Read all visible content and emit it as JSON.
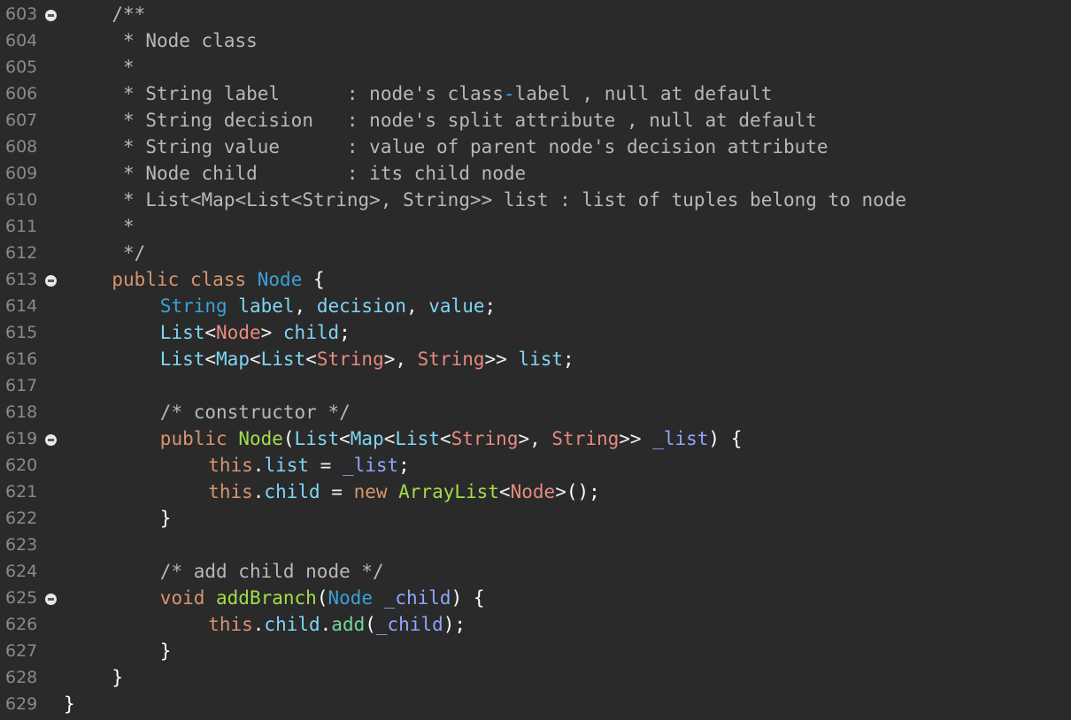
{
  "editor": {
    "indent_unit": 4,
    "lines": [
      {
        "num": "603",
        "fold": true,
        "indent": 1,
        "tokens": [
          {
            "t": "/**",
            "c": "cm"
          }
        ]
      },
      {
        "num": "604",
        "fold": false,
        "indent": 1,
        "tokens": [
          {
            "t": " * Node class",
            "c": "cm"
          }
        ]
      },
      {
        "num": "605",
        "fold": false,
        "indent": 1,
        "tokens": [
          {
            "t": " *",
            "c": "cm"
          }
        ]
      },
      {
        "num": "606",
        "fold": false,
        "indent": 1,
        "tokens": [
          {
            "t": " * String label      : node's class",
            "c": "cm"
          },
          {
            "t": "-",
            "c": "ty"
          },
          {
            "t": "label , null at default",
            "c": "cm"
          }
        ]
      },
      {
        "num": "607",
        "fold": false,
        "indent": 1,
        "tokens": [
          {
            "t": " * String decision   : node's split attribute , null at default",
            "c": "cm"
          }
        ]
      },
      {
        "num": "608",
        "fold": false,
        "indent": 1,
        "tokens": [
          {
            "t": " * String value      : value of parent node's decision attribute",
            "c": "cm"
          }
        ]
      },
      {
        "num": "609",
        "fold": false,
        "indent": 1,
        "tokens": [
          {
            "t": " * Node child        : its child node",
            "c": "cm"
          }
        ]
      },
      {
        "num": "610",
        "fold": false,
        "indent": 1,
        "tokens": [
          {
            "t": " * List<Map<List<String>, String>> list : list of tuples belong to node",
            "c": "cm"
          }
        ]
      },
      {
        "num": "611",
        "fold": false,
        "indent": 1,
        "tokens": [
          {
            "t": " *",
            "c": "cm"
          }
        ]
      },
      {
        "num": "612",
        "fold": false,
        "indent": 1,
        "tokens": [
          {
            "t": " */",
            "c": "cm"
          }
        ]
      },
      {
        "num": "613",
        "fold": true,
        "indent": 1,
        "tokens": [
          {
            "t": "public class ",
            "c": "kw"
          },
          {
            "t": "Node",
            "c": "ty"
          },
          {
            "t": " {",
            "c": "pu"
          }
        ]
      },
      {
        "num": "614",
        "fold": false,
        "indent": 2,
        "tokens": [
          {
            "t": "String",
            "c": "ty"
          },
          {
            "t": " label",
            "c": "fd"
          },
          {
            "t": ", ",
            "c": "pl"
          },
          {
            "t": "decision",
            "c": "fd"
          },
          {
            "t": ", ",
            "c": "pl"
          },
          {
            "t": "value",
            "c": "fd"
          },
          {
            "t": ";",
            "c": "pu"
          }
        ]
      },
      {
        "num": "615",
        "fold": false,
        "indent": 2,
        "tokens": [
          {
            "t": "List",
            "c": "fd"
          },
          {
            "t": "<",
            "c": "pl"
          },
          {
            "t": "Node",
            "c": "gn"
          },
          {
            "t": ">",
            "c": "pl"
          },
          {
            "t": " child",
            "c": "fd"
          },
          {
            "t": ";",
            "c": "pu"
          }
        ]
      },
      {
        "num": "616",
        "fold": false,
        "indent": 2,
        "tokens": [
          {
            "t": "List",
            "c": "fd"
          },
          {
            "t": "<",
            "c": "pl"
          },
          {
            "t": "Map",
            "c": "fd"
          },
          {
            "t": "<",
            "c": "pl"
          },
          {
            "t": "List",
            "c": "fd"
          },
          {
            "t": "<",
            "c": "pl"
          },
          {
            "t": "String",
            "c": "gn"
          },
          {
            "t": ">, ",
            "c": "pl"
          },
          {
            "t": "String",
            "c": "gn"
          },
          {
            "t": ">> ",
            "c": "pl"
          },
          {
            "t": "list",
            "c": "fd"
          },
          {
            "t": ";",
            "c": "pu"
          }
        ]
      },
      {
        "num": "617",
        "fold": false,
        "indent": 0,
        "tokens": []
      },
      {
        "num": "618",
        "fold": false,
        "indent": 2,
        "tokens": [
          {
            "t": "/* constructor */",
            "c": "cm"
          }
        ]
      },
      {
        "num": "619",
        "fold": true,
        "indent": 2,
        "tokens": [
          {
            "t": "public ",
            "c": "kw"
          },
          {
            "t": "Node",
            "c": "mt"
          },
          {
            "t": "(",
            "c": "pu"
          },
          {
            "t": "List",
            "c": "fd"
          },
          {
            "t": "<",
            "c": "pl"
          },
          {
            "t": "Map",
            "c": "fd"
          },
          {
            "t": "<",
            "c": "pl"
          },
          {
            "t": "List",
            "c": "fd"
          },
          {
            "t": "<",
            "c": "pl"
          },
          {
            "t": "String",
            "c": "gn"
          },
          {
            "t": ">, ",
            "c": "pl"
          },
          {
            "t": "String",
            "c": "gn"
          },
          {
            "t": ">> ",
            "c": "pl"
          },
          {
            "t": "_list",
            "c": "pm"
          },
          {
            "t": ") {",
            "c": "pu"
          }
        ]
      },
      {
        "num": "620",
        "fold": false,
        "indent": 3,
        "tokens": [
          {
            "t": "this",
            "c": "kw"
          },
          {
            "t": ".",
            "c": "pl"
          },
          {
            "t": "list",
            "c": "fd"
          },
          {
            "t": " = ",
            "c": "pl"
          },
          {
            "t": "_list",
            "c": "pm"
          },
          {
            "t": ";",
            "c": "pu"
          }
        ]
      },
      {
        "num": "621",
        "fold": false,
        "indent": 3,
        "tokens": [
          {
            "t": "this",
            "c": "kw"
          },
          {
            "t": ".",
            "c": "pl"
          },
          {
            "t": "child",
            "c": "fd"
          },
          {
            "t": " = ",
            "c": "pl"
          },
          {
            "t": "new ",
            "c": "kw"
          },
          {
            "t": "ArrayList",
            "c": "mt"
          },
          {
            "t": "<",
            "c": "pl"
          },
          {
            "t": "Node",
            "c": "gn"
          },
          {
            "t": ">",
            "c": "pl"
          },
          {
            "t": "();",
            "c": "pu"
          }
        ]
      },
      {
        "num": "622",
        "fold": false,
        "indent": 2,
        "tokens": [
          {
            "t": "}",
            "c": "pu"
          }
        ]
      },
      {
        "num": "623",
        "fold": false,
        "indent": 0,
        "tokens": []
      },
      {
        "num": "624",
        "fold": false,
        "indent": 2,
        "tokens": [
          {
            "t": "/* add child node */",
            "c": "cm"
          }
        ]
      },
      {
        "num": "625",
        "fold": true,
        "indent": 2,
        "tokens": [
          {
            "t": "void ",
            "c": "kw"
          },
          {
            "t": "addBranch",
            "c": "mt"
          },
          {
            "t": "(",
            "c": "pu"
          },
          {
            "t": "Node",
            "c": "ty"
          },
          {
            "t": " _child",
            "c": "pm"
          },
          {
            "t": ") {",
            "c": "pu"
          }
        ]
      },
      {
        "num": "626",
        "fold": false,
        "indent": 3,
        "tokens": [
          {
            "t": "this",
            "c": "kw"
          },
          {
            "t": ".",
            "c": "pl"
          },
          {
            "t": "child",
            "c": "fd"
          },
          {
            "t": ".",
            "c": "pl"
          },
          {
            "t": "add",
            "c": "mc"
          },
          {
            "t": "(",
            "c": "pu"
          },
          {
            "t": "_child",
            "c": "pm"
          },
          {
            "t": ");",
            "c": "pu"
          }
        ]
      },
      {
        "num": "627",
        "fold": false,
        "indent": 2,
        "tokens": [
          {
            "t": "}",
            "c": "pu"
          }
        ]
      },
      {
        "num": "628",
        "fold": false,
        "indent": 1,
        "tokens": [
          {
            "t": "}",
            "c": "pu"
          }
        ]
      },
      {
        "num": "629",
        "fold": false,
        "indent": 0,
        "tokens": [
          {
            "t": "}",
            "c": "pu"
          }
        ]
      }
    ]
  },
  "colors": {
    "background": "#2a2a2a",
    "line_number": "#8a8a8a",
    "comment": "#b8b8b8",
    "keyword": "#d8956e",
    "type": "#3aa1d9",
    "generic_type": "#e88a7e",
    "field": "#7ed6f6",
    "method_decl": "#a3dd4a",
    "method_call": "#6ed8a0",
    "parameter": "#8fa6ff",
    "punctuation": "#ffffff"
  }
}
